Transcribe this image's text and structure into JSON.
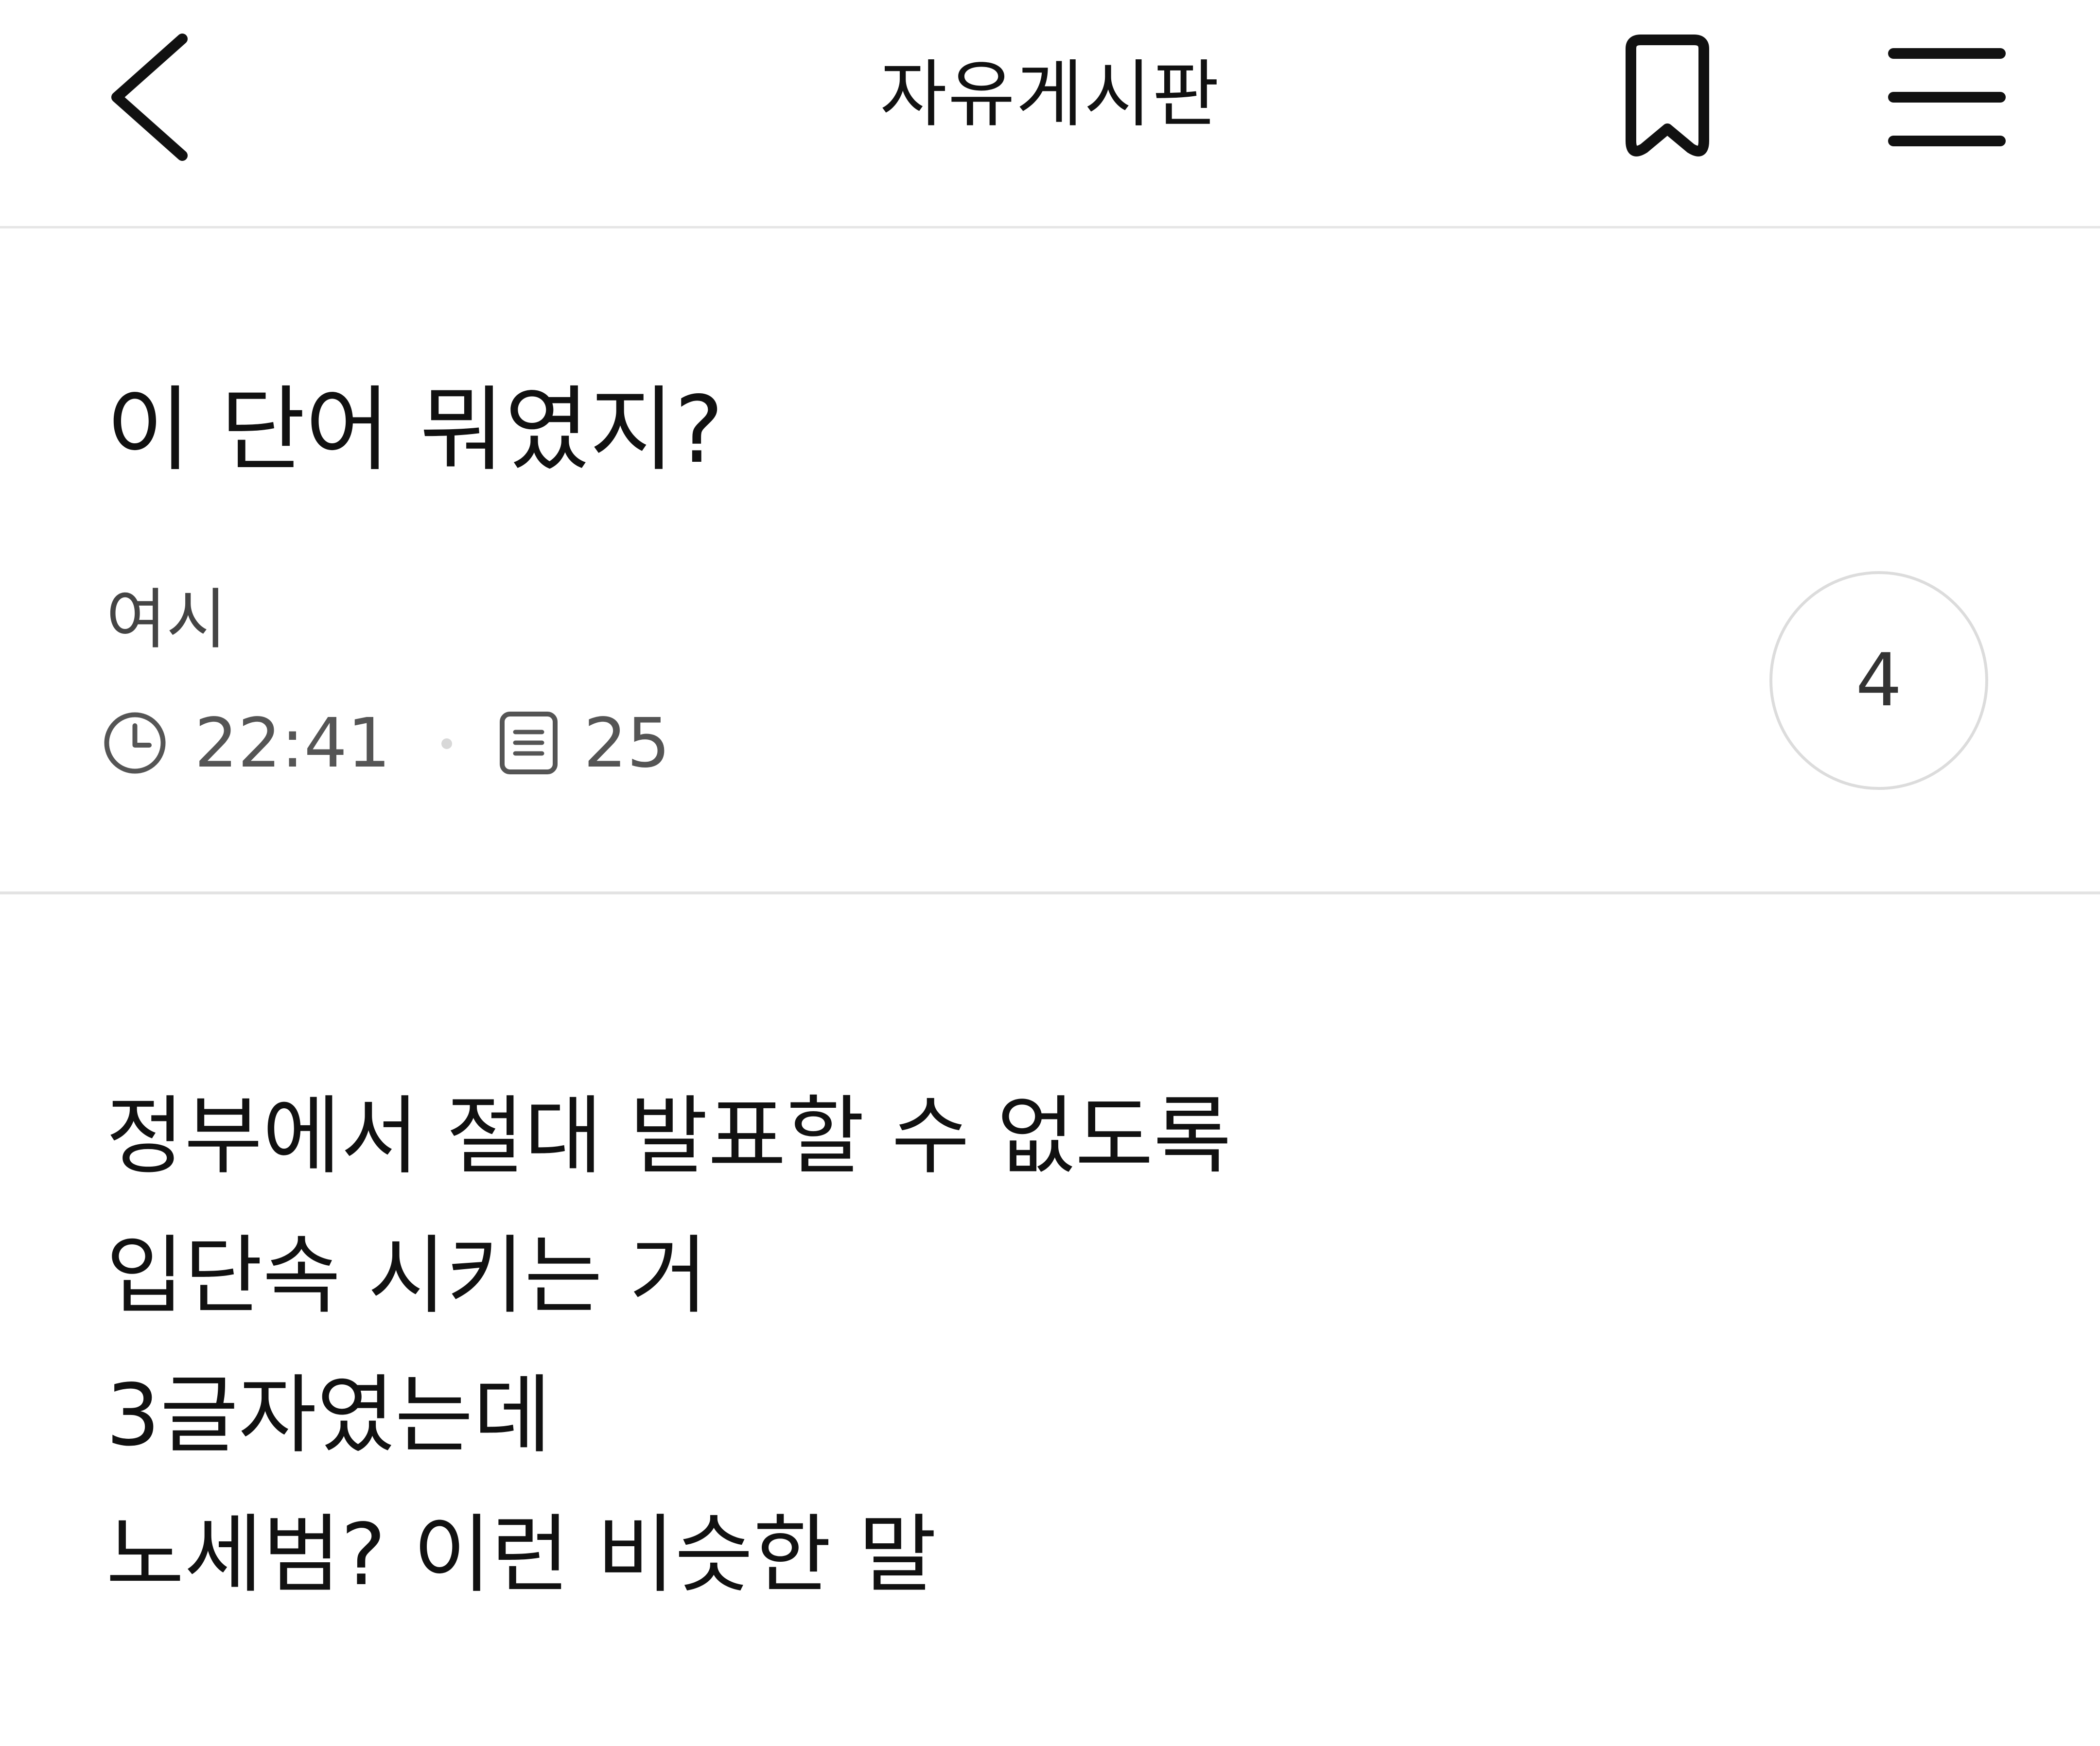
{
  "header": {
    "title": "자유게시판",
    "back_icon": "chevron-left-icon",
    "bookmark_icon": "bookmark-icon",
    "menu_icon": "hamburger-menu-icon"
  },
  "post": {
    "title": "이 단어 뭐였지?",
    "author": "여시",
    "time": "22:41",
    "views": "25",
    "comment_count": "4",
    "body_lines": [
      "정부에서 절대 발표할 수 없도록",
      "입단속 시키는 거",
      "3글자였는데",
      "노세범? 이런 비슷한 말"
    ]
  },
  "colors": {
    "text_primary": "#111111",
    "text_secondary": "#555555",
    "divider": "#e3e3e3",
    "background": "#ffffff"
  }
}
